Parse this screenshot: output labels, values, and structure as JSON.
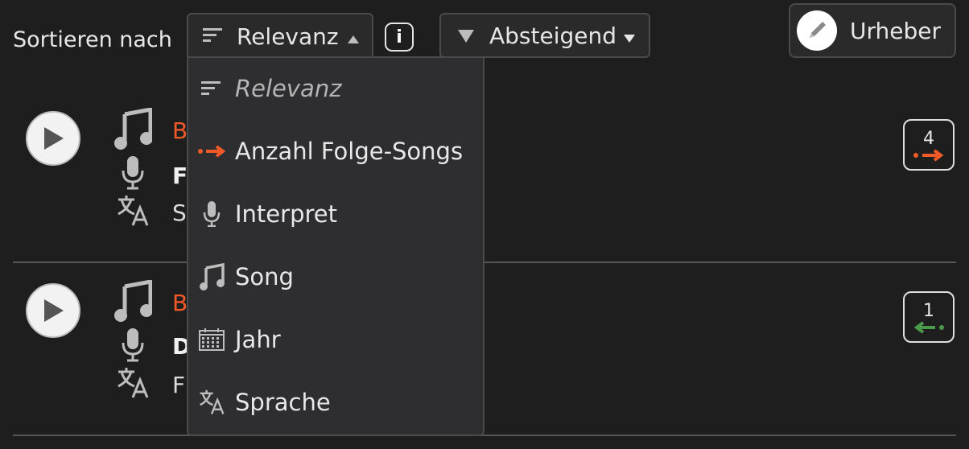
{
  "toolbar": {
    "sort_label": "Sortieren nach",
    "sort_selected": "Relevanz",
    "info_label": "i",
    "order_selected": "Absteigend",
    "author_label": "Urheber"
  },
  "dropdown": {
    "items": [
      {
        "label": "Relevanz",
        "icon": "sort-lines-icon",
        "active": true
      },
      {
        "label": "Anzahl Folge-Songs",
        "icon": "arrow-right-dot-icon"
      },
      {
        "label": "Interpret",
        "icon": "microphone-icon"
      },
      {
        "label": "Song",
        "icon": "music-note-icon"
      },
      {
        "label": "Jahr",
        "icon": "calendar-icon"
      },
      {
        "label": "Sprache",
        "icon": "translate-icon"
      }
    ]
  },
  "rows": [
    {
      "title": "B",
      "artist": "F",
      "language": "S",
      "count": "4",
      "direction": "forward"
    },
    {
      "title": "B",
      "artist": "D",
      "language": "F",
      "count": "1",
      "direction": "back"
    }
  ],
  "colors": {
    "accent_orange": "#f05a28",
    "accent_green": "#4a9a4a",
    "background": "#1e1e1e"
  }
}
